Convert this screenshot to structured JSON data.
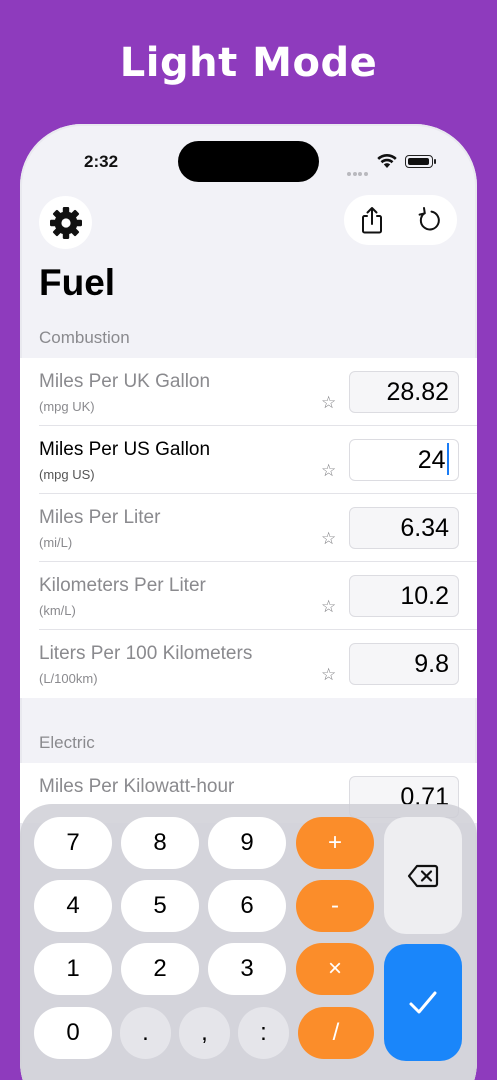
{
  "banner": {
    "text": "Light Mode"
  },
  "status_bar": {
    "time": "2:32"
  },
  "header": {
    "title": "Fuel",
    "settings_icon": "gear-icon",
    "share_icon": "share-icon",
    "reset_icon": "rotate-left-icon"
  },
  "sections": [
    {
      "header": "Combustion",
      "rows": [
        {
          "name": "Miles Per UK Gallon",
          "abbr": "(mpg UK)",
          "value": "28.82",
          "favorite": false,
          "active": false
        },
        {
          "name": "Miles Per US Gallon",
          "abbr": "(mpg US)",
          "value": "24",
          "favorite": false,
          "active": true
        },
        {
          "name": "Miles Per Liter",
          "abbr": "(mi/L)",
          "value": "6.34",
          "favorite": false,
          "active": false
        },
        {
          "name": "Kilometers Per Liter",
          "abbr": "(km/L)",
          "value": "10.2",
          "favorite": false,
          "active": false
        },
        {
          "name": "Liters Per 100 Kilometers",
          "abbr": "(L/100km)",
          "value": "9.8",
          "favorite": false,
          "active": false
        }
      ]
    },
    {
      "header": "Electric",
      "rows": [
        {
          "name": "Miles Per Kilowatt-hour",
          "abbr": "",
          "value": "0.71",
          "favorite": false,
          "active": false
        }
      ]
    }
  ],
  "keypad": {
    "keys": {
      "k7": "7",
      "k8": "8",
      "k9": "9",
      "plus": "+",
      "k4": "4",
      "k5": "5",
      "k6": "6",
      "minus": "-",
      "k1": "1",
      "k2": "2",
      "k3": "3",
      "times": "×",
      "k0": "0",
      "dot": ".",
      "comma": ",",
      "colon": ":",
      "divide": "/"
    },
    "delete_icon": "backspace-icon",
    "done_icon": "checkmark-icon"
  },
  "colors": {
    "background": "#8e3bbd",
    "operator": "#fb8d2a",
    "accent": "#1a86fa",
    "caret": "#1a7cf5"
  }
}
